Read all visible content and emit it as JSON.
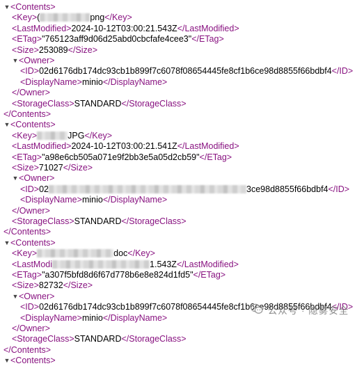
{
  "toggle_expanded": "▼",
  "blocks": [
    {
      "key": {
        "open": "<Key>",
        "pre": "(",
        "post": "png",
        "close": "</Key>"
      },
      "last_modified": {
        "open": "<LastModified>",
        "value": "2024-10-12T03:00:21.543Z",
        "close": "</LastModified>"
      },
      "etag": {
        "open": "<ETag>",
        "value": "\"765123aff9d06d25abd0cbcfafe4cee3\"",
        "close": "</ETag>"
      },
      "size": {
        "open": "<Size>",
        "value": "253089",
        "close": "</Size>"
      },
      "owner_open": "<Owner>",
      "owner_id": {
        "open": "<ID>",
        "value": "02d6176db174dc93cb1b899f7c6078f08654445fe8cf1b6ce98d8855f66bdbf4",
        "close": "</ID>"
      },
      "owner_display": {
        "open": "<DisplayName>",
        "value": "minio",
        "close": "</DisplayName>"
      },
      "owner_close": "</Owner>",
      "storage_class": {
        "open": "<StorageClass>",
        "value": "STANDARD",
        "close": "</StorageClass>"
      }
    },
    {
      "key": {
        "open": "<Key>",
        "pre": "",
        "post": "JPG",
        "close": "</Key>"
      },
      "last_modified": {
        "open": "<LastModified>",
        "value": "2024-10-12T03:00:21.541Z",
        "close": "</LastModified>"
      },
      "etag": {
        "open": "<ETag>",
        "value": "\"a98e6cb505a071e9f2bb3e5a05d2cb59\"",
        "close": "</ETag>"
      },
      "size": {
        "open": "<Size>",
        "value": "71027",
        "close": "</Size>"
      },
      "owner_open": "<Owner>",
      "owner_id": {
        "open": "<ID>",
        "pre": "02",
        "post": "3ce98d8855f66bdbf4",
        "close": "</ID>"
      },
      "owner_display": {
        "open": "<DisplayName>",
        "value": "minio",
        "close": "</DisplayName>"
      },
      "owner_close": "</Owner>",
      "storage_class": {
        "open": "<StorageClass>",
        "value": "STANDARD",
        "close": "</StorageClass>"
      }
    },
    {
      "key": {
        "open": "<Key>",
        "pre": "",
        "post": "doc",
        "close": "</Key>"
      },
      "last_modified": {
        "open": "<LastModi",
        "value": "1.543Z",
        "close": "</LastModified>"
      },
      "etag": {
        "open": "<ETag>",
        "value": "\"a307f5bfd8d6f67d778b6e8e824d1fd5\"",
        "close": "</ETag>"
      },
      "size": {
        "open": "<Size>",
        "value": "82732",
        "close": "</Size>"
      },
      "owner_open": "<Owner>",
      "owner_id": {
        "open": "<ID>",
        "value": "02d6176db174dc93cb1b899f7c6078f08654445fe8cf1b6ce98d8855f66bdbf4",
        "close": "</ID>"
      },
      "owner_display": {
        "open": "<DisplayName>",
        "value": "minio",
        "close": "</DisplayName>"
      },
      "owner_close": "</Owner>",
      "storage_class": {
        "open": "<StorageClass>",
        "value": "STANDARD",
        "close": "</StorageClass>"
      }
    }
  ],
  "contents_open": "<Contents>",
  "contents_close": "</Contents>",
  "trailing_open": "<Contents>",
  "watermark": {
    "text": "公众号 · 隐雾安全",
    "icon": "wechat-icon"
  }
}
